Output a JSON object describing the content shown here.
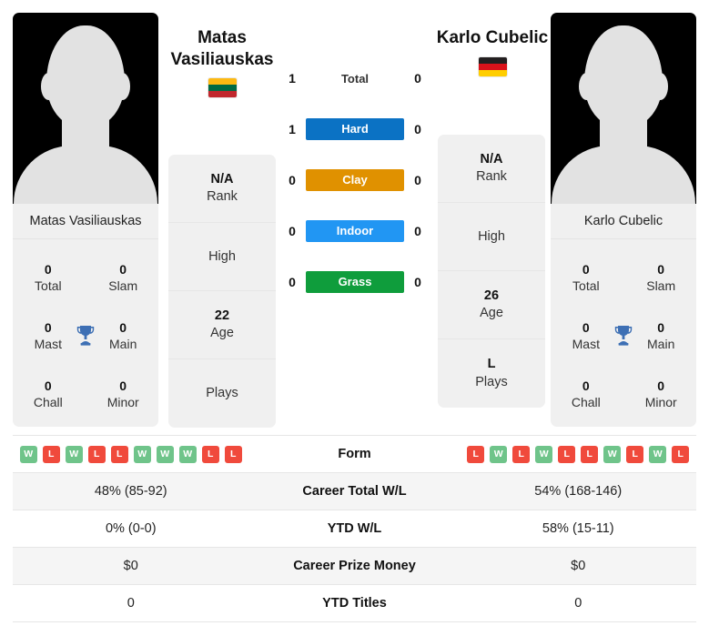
{
  "players": {
    "left": {
      "name": "Matas Vasiliauskas",
      "name_line1": "Matas",
      "name_line2": "Vasiliauskas",
      "flag_country": "Lithuania",
      "flag_colors": [
        "#fdb913",
        "#006a44",
        "#c1272d"
      ],
      "titles": {
        "total": "0",
        "total_label": "Total",
        "slam": "0",
        "slam_label": "Slam",
        "mast": "0",
        "mast_label": "Mast",
        "main": "0",
        "main_label": "Main",
        "chall": "0",
        "chall_label": "Chall",
        "minor": "0",
        "minor_label": "Minor"
      },
      "info": {
        "rank_value": "N/A",
        "rank_label": "Rank",
        "high_value": "",
        "high_label": "High",
        "age_value": "22",
        "age_label": "Age",
        "plays_value": "",
        "plays_label": "Plays"
      },
      "form": [
        "W",
        "L",
        "W",
        "L",
        "L",
        "W",
        "W",
        "W",
        "L",
        "L"
      ],
      "career_total_wl": "48% (85-92)",
      "ytd_wl": "0% (0-0)",
      "career_prize_money": "$0",
      "ytd_titles": "0"
    },
    "right": {
      "name": "Karlo Cubelic",
      "name_line1": "Karlo Cubelic",
      "name_line2": "",
      "flag_country": "Germany",
      "flag_colors": [
        "#231f20",
        "#da121a",
        "#ffce00"
      ],
      "titles": {
        "total": "0",
        "total_label": "Total",
        "slam": "0",
        "slam_label": "Slam",
        "mast": "0",
        "mast_label": "Mast",
        "main": "0",
        "main_label": "Main",
        "chall": "0",
        "chall_label": "Chall",
        "minor": "0",
        "minor_label": "Minor"
      },
      "info": {
        "rank_value": "N/A",
        "rank_label": "Rank",
        "high_value": "",
        "high_label": "High",
        "age_value": "26",
        "age_label": "Age",
        "plays_value": "L",
        "plays_label": "Plays"
      },
      "form": [
        "L",
        "W",
        "L",
        "W",
        "L",
        "L",
        "W",
        "L",
        "W",
        "L"
      ],
      "career_total_wl": "54% (168-146)",
      "ytd_wl": "58% (15-11)",
      "career_prize_money": "$0",
      "ytd_titles": "0"
    }
  },
  "head_to_head": {
    "rows": [
      {
        "label": "Total",
        "left": "1",
        "right": "0",
        "is_badge": false,
        "color": ""
      },
      {
        "label": "Hard",
        "left": "1",
        "right": "0",
        "is_badge": true,
        "color": "#0b72c4"
      },
      {
        "label": "Clay",
        "left": "0",
        "right": "0",
        "is_badge": true,
        "color": "#e09100"
      },
      {
        "label": "Indoor",
        "left": "0",
        "right": "0",
        "is_badge": true,
        "color": "#2196f3"
      },
      {
        "label": "Grass",
        "left": "0",
        "right": "0",
        "is_badge": true,
        "color": "#0f9d3c"
      }
    ]
  },
  "stats_table": {
    "rows": [
      {
        "label": "Form",
        "left": "",
        "right": "",
        "type": "form"
      },
      {
        "label": "Career Total W/L",
        "left": "48% (85-92)",
        "right": "54% (168-146)",
        "type": "text"
      },
      {
        "label": "YTD W/L",
        "left": "0% (0-0)",
        "right": "58% (15-11)",
        "type": "text"
      },
      {
        "label": "Career Prize Money",
        "left": "$0",
        "right": "$0",
        "type": "text"
      },
      {
        "label": "YTD Titles",
        "left": "0",
        "right": "0",
        "type": "text"
      }
    ]
  },
  "colors": {
    "win_badge": "#6fc48a",
    "loss_badge": "#f04a3c",
    "trophy": "#3d6fb4",
    "card_bg": "#f0f0f0",
    "row_stripe": "#f5f5f5"
  },
  "icons": {
    "trophy": "trophy-icon",
    "avatar": "player-avatar-placeholder-icon"
  }
}
